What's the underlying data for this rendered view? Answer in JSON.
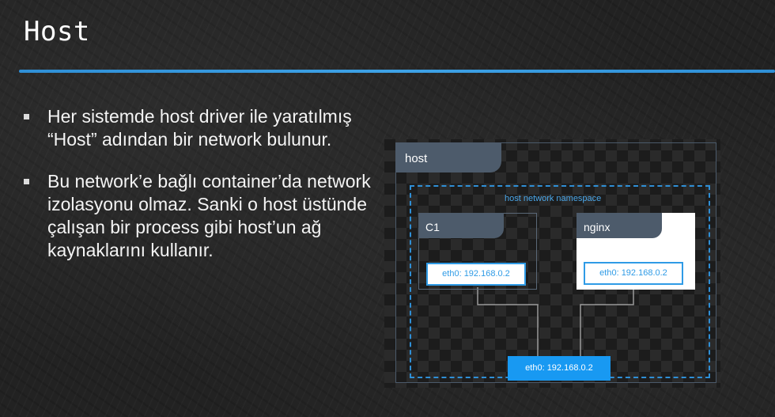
{
  "slide": {
    "title": "Host",
    "bullets": [
      "Her sistemde host driver ile yaratılmış “Host” adından bir network bulunur.",
      "Bu network’e bağlı container’da network izolasyonu olmaz. Sanki o host üstünde çalışan bir process gibi host’un ağ kaynaklarını kullanır."
    ]
  },
  "diagram": {
    "host_label": "host",
    "namespace_label": "host network namespace",
    "containers": [
      {
        "name": "C1",
        "eth": "eth0: 192.168.0.2"
      },
      {
        "name": "nginx",
        "eth": "eth0: 192.168.0.2"
      }
    ],
    "host_eth": "eth0: 192.168.0.2"
  },
  "colors": {
    "accent_blue": "#2f8fd6",
    "tab_gray": "#4d5b6b",
    "host_eth_fill": "#1899f2"
  }
}
